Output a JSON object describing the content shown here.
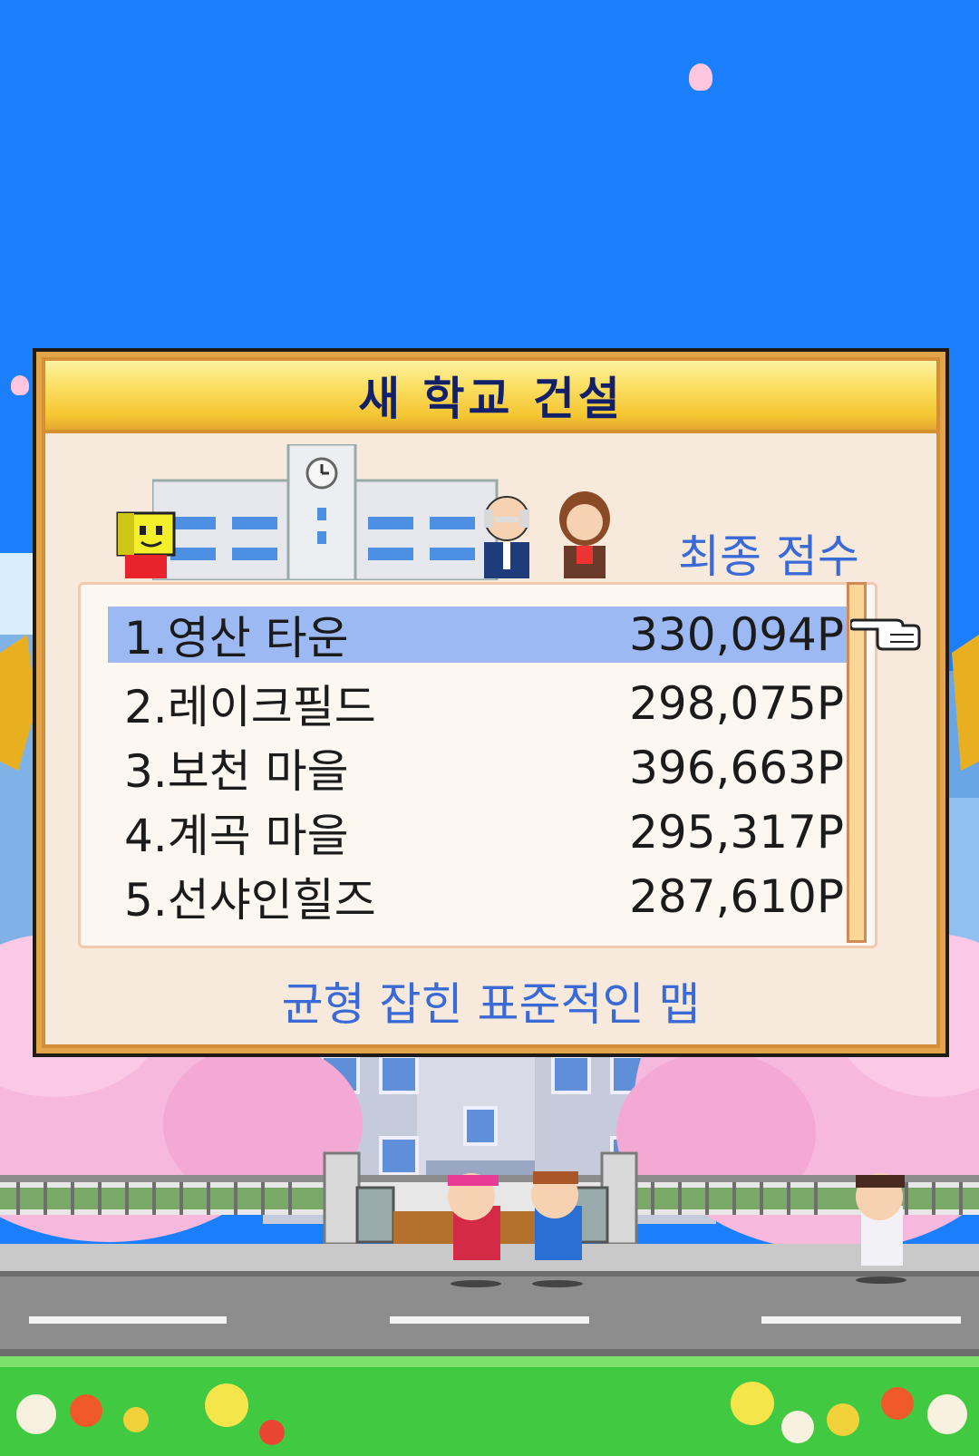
{
  "dialog": {
    "title": "새 학교 건설",
    "score_label": "최종 점수",
    "description": "균형 잡힌 표준적인 맵"
  },
  "rankings": [
    {
      "name": "1.영산 타운",
      "score": "330,094P"
    },
    {
      "name": "2.레이크필드",
      "score": "298,075P"
    },
    {
      "name": "3.보천 마을",
      "score": "396,663P"
    },
    {
      "name": "4.계곡 마을",
      "score": "295,317P"
    },
    {
      "name": "5.선샤인힐즈",
      "score": "287,610P"
    }
  ],
  "selected_index": 0,
  "icons": {
    "pointer": "pointing-hand-icon",
    "mascot": "yellow-robot-mascot",
    "principal": "old-principal-character",
    "teacher": "female-teacher-character"
  },
  "colors": {
    "sky": "#1b7ffb",
    "title_text": "#12206a",
    "label_text": "#3a6ad6",
    "selection": "#9db9f3",
    "sakura": "#f7b8dd"
  }
}
